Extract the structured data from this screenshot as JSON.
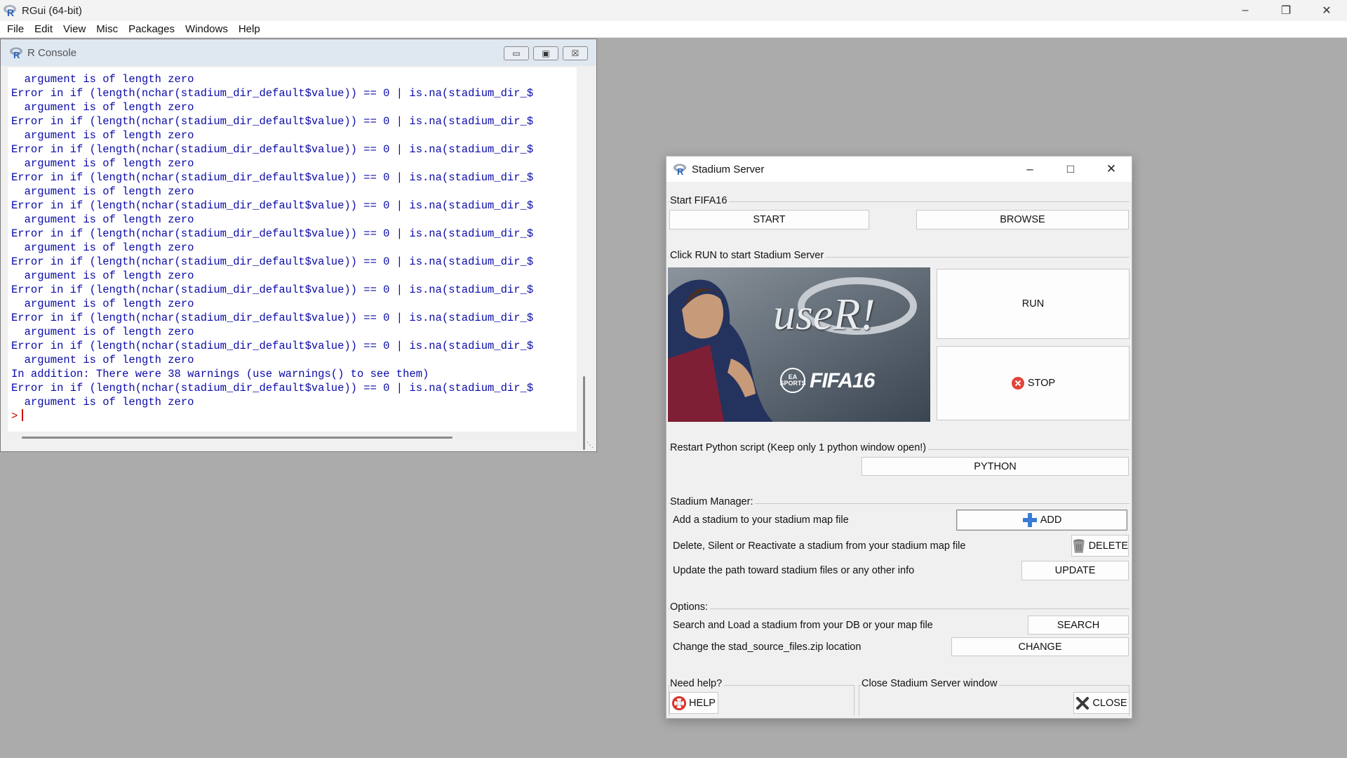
{
  "app": {
    "title": "RGui (64-bit)",
    "menu": [
      "File",
      "Edit",
      "View",
      "Misc",
      "Packages",
      "Windows",
      "Help"
    ]
  },
  "console": {
    "title": "R Console",
    "lines": [
      "  argument is of length zero",
      "Error in if (length(nchar(stadium_dir_default$value)) == 0 | is.na(stadium_dir_$",
      "  argument is of length zero",
      "Error in if (length(nchar(stadium_dir_default$value)) == 0 | is.na(stadium_dir_$",
      "  argument is of length zero",
      "Error in if (length(nchar(stadium_dir_default$value)) == 0 | is.na(stadium_dir_$",
      "  argument is of length zero",
      "Error in if (length(nchar(stadium_dir_default$value)) == 0 | is.na(stadium_dir_$",
      "  argument is of length zero",
      "Error in if (length(nchar(stadium_dir_default$value)) == 0 | is.na(stadium_dir_$",
      "  argument is of length zero",
      "Error in if (length(nchar(stadium_dir_default$value)) == 0 | is.na(stadium_dir_$",
      "  argument is of length zero",
      "Error in if (length(nchar(stadium_dir_default$value)) == 0 | is.na(stadium_dir_$",
      "  argument is of length zero",
      "Error in if (length(nchar(stadium_dir_default$value)) == 0 | is.na(stadium_dir_$",
      "  argument is of length zero",
      "Error in if (length(nchar(stadium_dir_default$value)) == 0 | is.na(stadium_dir_$",
      "  argument is of length zero",
      "Error in if (length(nchar(stadium_dir_default$value)) == 0 | is.na(stadium_dir_$",
      "  argument is of length zero",
      "In addition: There were 38 warnings (use warnings() to see them)",
      "Error in if (length(nchar(stadium_dir_default$value)) == 0 | is.na(stadium_dir_$",
      "  argument is of length zero"
    ],
    "prompt": ">"
  },
  "dialog": {
    "title": "Stadium Server",
    "start_group": {
      "label": "Start FIFA16",
      "start_btn": "START",
      "browse_btn": "BROWSE"
    },
    "run_group": {
      "label": "Click RUN to start Stadium Server",
      "run_btn": "RUN",
      "stop_btn": "STOP",
      "poster_text_1": "useR!",
      "poster_text_2": "FIFA16",
      "poster_ea": "EA SPORTS"
    },
    "python_group": {
      "label": "Restart Python script (Keep only 1 python window open!)",
      "python_btn": "PYTHON"
    },
    "manager_group": {
      "label": "Stadium Manager:",
      "add_text": "Add a stadium to your stadium map file",
      "add_btn": "ADD",
      "delete_text": "Delete, Silent or Reactivate a stadium from your stadium map file",
      "delete_btn": "DELETE",
      "update_text": "Update the path toward stadium files or any other info",
      "update_btn": "UPDATE"
    },
    "options_group": {
      "label": "Options:",
      "search_text": "Search and Load a stadium from your DB or your map file",
      "search_btn": "SEARCH",
      "change_text": "Change the stad_source_files.zip location",
      "change_btn": "CHANGE"
    },
    "help_group": {
      "label": "Need help?",
      "help_btn": "HELP"
    },
    "close_group": {
      "label": "Close Stadium Server window",
      "close_btn": "CLOSE"
    }
  },
  "colors": {
    "console_text": "#0a0aaa",
    "prompt": "#d00000",
    "desktop": "#ababab"
  }
}
